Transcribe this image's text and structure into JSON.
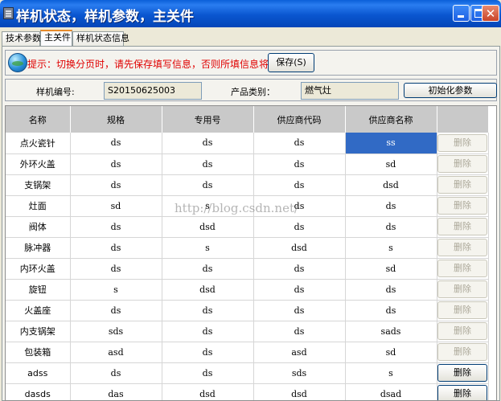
{
  "window": {
    "title": "样机状态，样机参数，主关件",
    "colors": {
      "title_bar": "#0a56d0",
      "hint_text": "#e00000",
      "selection": "#316ac5"
    }
  },
  "tabs": [
    {
      "label": "技术参数"
    },
    {
      "label": "主关件",
      "active": true
    },
    {
      "label": "样机状态信息"
    }
  ],
  "hint": {
    "icon": "globe-icon",
    "text": "提示：切换分页时，请先保存填写信息，否则所填信息将被清空!",
    "save_label": "保存(S)"
  },
  "info": {
    "serial_label": "样机编号:",
    "serial_value": "S20150625003",
    "category_label": "产品类别：",
    "category_value": "燃气灶",
    "init_label": "初始化参数"
  },
  "table": {
    "columns": [
      "名称",
      "规格",
      "专用号",
      "供应商代码",
      "供应商名称",
      ""
    ],
    "delete_label": "删除",
    "rows": [
      {
        "name": "点火瓷针",
        "spec": "ds",
        "code": "ds",
        "supplier_code": "ds",
        "supplier_name": "ss",
        "selected": true,
        "delete_enabled": false
      },
      {
        "name": "外环火盖",
        "spec": "ds",
        "code": "ds",
        "supplier_code": "ds",
        "supplier_name": "sd",
        "delete_enabled": false
      },
      {
        "name": "支锅架",
        "spec": "ds",
        "code": "ds",
        "supplier_code": "ds",
        "supplier_name": "dsd",
        "delete_enabled": false
      },
      {
        "name": "灶面",
        "spec": "sd",
        "code": "s",
        "supplier_code": "ds",
        "supplier_name": "ds",
        "delete_enabled": false
      },
      {
        "name": "阀体",
        "spec": "ds",
        "code": "dsd",
        "supplier_code": "ds",
        "supplier_name": "ds",
        "delete_enabled": false
      },
      {
        "name": "脉冲器",
        "spec": "ds",
        "code": "s",
        "supplier_code": "dsd",
        "supplier_name": "s",
        "delete_enabled": false
      },
      {
        "name": "内环火盖",
        "spec": "ds",
        "code": "ds",
        "supplier_code": "ds",
        "supplier_name": "sd",
        "delete_enabled": false
      },
      {
        "name": "旋钮",
        "spec": "s",
        "code": "dsd",
        "supplier_code": "ds",
        "supplier_name": "ds",
        "delete_enabled": false
      },
      {
        "name": "火盖座",
        "spec": "ds",
        "code": "ds",
        "supplier_code": "ds",
        "supplier_name": "ds",
        "delete_enabled": false
      },
      {
        "name": "内支锅架",
        "spec": "sds",
        "code": "ds",
        "supplier_code": "ds",
        "supplier_name": "sads",
        "delete_enabled": false
      },
      {
        "name": "包装箱",
        "spec": "asd",
        "code": "ds",
        "supplier_code": "asd",
        "supplier_name": "sd",
        "delete_enabled": false
      },
      {
        "name": "adss",
        "spec": "ds",
        "code": "ds",
        "supplier_code": "sds",
        "supplier_name": "s",
        "delete_enabled": true
      },
      {
        "name": "dasds",
        "spec": "das",
        "code": "dsd",
        "supplier_code": "dsd",
        "supplier_name": "dsad",
        "delete_enabled": true
      }
    ]
  },
  "watermark": "http://blog.csdn.net/"
}
